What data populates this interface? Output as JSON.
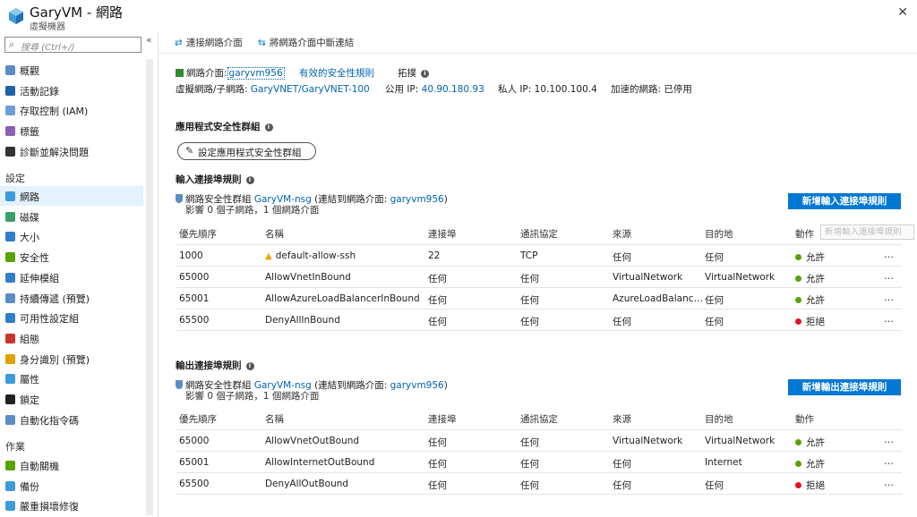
{
  "header": {
    "title": "GaryVM - 網路",
    "subtitle": "虛擬機器",
    "close": "✕"
  },
  "sidebar": {
    "collapse": "«",
    "search_placeholder": "搜尋 (Ctrl+/)",
    "top_items": [
      {
        "label": "概觀",
        "icon": "overview-icon",
        "color": "#5b8cc6"
      },
      {
        "label": "活動記錄",
        "icon": "activity-log-icon",
        "color": "#1f5fa8"
      },
      {
        "label": "存取控制 (IAM)",
        "icon": "iam-icon",
        "color": "#6aa0d8"
      },
      {
        "label": "標籤",
        "icon": "tag-icon",
        "color": "#8a5fb8"
      },
      {
        "label": "診斷並解決問題",
        "icon": "diagnose-icon",
        "color": "#333333"
      }
    ],
    "settings_label": "設定",
    "settings_items": [
      {
        "label": "網路",
        "icon": "network-icon",
        "color": "#3c9bd8",
        "active": true
      },
      {
        "label": "磁碟",
        "icon": "disk-icon",
        "color": "#3aa06a"
      },
      {
        "label": "大小",
        "icon": "size-icon",
        "color": "#2f7fc8"
      },
      {
        "label": "安全性",
        "icon": "security-icon",
        "color": "#57a300"
      },
      {
        "label": "延伸模組",
        "icon": "extensions-icon",
        "color": "#2f7fc8"
      },
      {
        "label": "持續傳遞 (預覽)",
        "icon": "continuous-delivery-icon",
        "color": "#5b8cc6"
      },
      {
        "label": "可用性設定組",
        "icon": "availability-set-icon",
        "color": "#2f7fc8"
      },
      {
        "label": "組態",
        "icon": "configuration-icon",
        "color": "#c8342b"
      },
      {
        "label": "身分識別 (預覽)",
        "icon": "identity-icon",
        "color": "#e0a000"
      },
      {
        "label": "屬性",
        "icon": "properties-icon",
        "color": "#3c9bd8"
      },
      {
        "label": "鎖定",
        "icon": "lock-icon",
        "color": "#222222"
      },
      {
        "label": "自動化指令碼",
        "icon": "automation-script-icon",
        "color": "#5b8cc6"
      }
    ],
    "operations_label": "作業",
    "operations_items": [
      {
        "label": "自動關機",
        "icon": "auto-shutdown-icon",
        "color": "#57a300"
      },
      {
        "label": "備份",
        "icon": "backup-icon",
        "color": "#3c9bd8"
      },
      {
        "label": "嚴重損壞修復",
        "icon": "disaster-recovery-icon",
        "color": "#3c9bd8"
      }
    ]
  },
  "toolbar": {
    "attach_label": "連接網路介面",
    "detach_label": "將網路介面中斷連結"
  },
  "nic": {
    "label": "網路介面:",
    "name": "garyvm956",
    "effective_rules": "有效的安全性規則",
    "topology": "拓撲",
    "vnet_label": "虛擬網路/子網路:",
    "vnet_value": "GaryVNET/GaryVNET-100",
    "public_ip_label": "公用 IP:",
    "public_ip": "40.90.180.93",
    "private_ip_label": "私人 IP:",
    "private_ip": "10.100.100.4",
    "accel_label": "加速的網路:",
    "accel_value": "已停用"
  },
  "asg": {
    "heading": "應用程式安全性群組",
    "button": "設定應用程式安全性群組"
  },
  "columns": [
    "優先順序",
    "名稱",
    "連接埠",
    "通訊協定",
    "來源",
    "目的地",
    "動作"
  ],
  "inbound": {
    "heading": "輸入連接埠規則",
    "nsg_prefix": "網路安全性群組",
    "nsg_name": "GaryVM-nsg",
    "nsg_attached_prefix": "(連結到網路介面:",
    "nsg_attached_nic": "garyvm956",
    "nsg_attached_suffix": ")",
    "impact": "影響 0 個子網路，1 個網路介面",
    "add_button": "新增輸入連接埠規則",
    "tooltip": "新增輸入連接埠規則",
    "rows": [
      {
        "priority": "1000",
        "name": "default-allow-ssh",
        "warn": true,
        "port": "22",
        "protocol": "TCP",
        "source": "任何",
        "destination": "任何",
        "action": "允許",
        "allow": true
      },
      {
        "priority": "65000",
        "name": "AllowVnetInBound",
        "warn": false,
        "port": "任何",
        "protocol": "任何",
        "source": "VirtualNetwork",
        "destination": "VirtualNetwork",
        "action": "允許",
        "allow": true
      },
      {
        "priority": "65001",
        "name": "AllowAzureLoadBalancerInBound",
        "warn": false,
        "port": "任何",
        "protocol": "任何",
        "source": "AzureLoadBalanc…",
        "destination": "任何",
        "action": "允許",
        "allow": true
      },
      {
        "priority": "65500",
        "name": "DenyAllInBound",
        "warn": false,
        "port": "任何",
        "protocol": "任何",
        "source": "任何",
        "destination": "任何",
        "action": "拒絕",
        "allow": false
      }
    ]
  },
  "outbound": {
    "heading": "輸出連接埠規則",
    "nsg_prefix": "網路安全性群組",
    "nsg_name": "GaryVM-nsg",
    "nsg_attached_prefix": "(連結到網路介面:",
    "nsg_attached_nic": "garyvm956",
    "nsg_attached_suffix": ")",
    "impact": "影響 0 個子網路，1 個網路介面",
    "add_button": "新增輸出連接埠規則",
    "rows": [
      {
        "priority": "65000",
        "name": "AllowVnetOutBound",
        "warn": false,
        "port": "任何",
        "protocol": "任何",
        "source": "VirtualNetwork",
        "destination": "VirtualNetwork",
        "action": "允許",
        "allow": true
      },
      {
        "priority": "65001",
        "name": "AllowInternetOutBound",
        "warn": false,
        "port": "任何",
        "protocol": "任何",
        "source": "任何",
        "destination": "Internet",
        "action": "允許",
        "allow": true
      },
      {
        "priority": "65500",
        "name": "DenyAllOutBound",
        "warn": false,
        "port": "任何",
        "protocol": "任何",
        "source": "任何",
        "destination": "任何",
        "action": "拒絕",
        "allow": false
      }
    ]
  },
  "more_glyph": "…"
}
